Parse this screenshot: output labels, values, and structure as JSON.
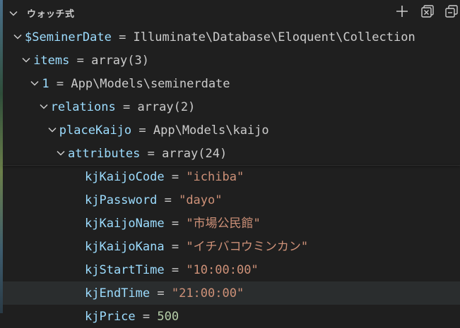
{
  "panel": {
    "title": "ウォッチ式",
    "actions": [
      {
        "icon": "add-icon"
      },
      {
        "icon": "collapse-all-icon"
      },
      {
        "icon": "remove-all-icon"
      }
    ]
  },
  "tree": [
    {
      "name": "$SeminerDate",
      "value": "Illuminate\\Database\\Eloquent\\Collection",
      "value_type": "plain",
      "expandable": true
    },
    {
      "name": "items",
      "value": "array(3)",
      "value_type": "plain",
      "expandable": true
    },
    {
      "name": "1",
      "value": "App\\Models\\seminerdate",
      "value_type": "plain",
      "expandable": true
    },
    {
      "name": "relations",
      "value": "array(2)",
      "value_type": "plain",
      "expandable": true
    },
    {
      "name": "placeKaijo",
      "value": "App\\Models\\kaijo",
      "value_type": "plain",
      "expandable": true
    },
    {
      "name": "attributes",
      "value": "array(24)",
      "value_type": "plain",
      "expandable": true
    },
    {
      "name": "kjKaijoCode",
      "value": "\"ichiba\"",
      "value_type": "string",
      "expandable": false
    },
    {
      "name": "kjPassword",
      "value": "\"dayo\"",
      "value_type": "string",
      "expandable": false
    },
    {
      "name": "kjKaijoName",
      "value": "\"市場公民館\"",
      "value_type": "string",
      "expandable": false
    },
    {
      "name": "kjKaijoKana",
      "value": "\"イチバコウミンカン\"",
      "value_type": "string",
      "expandable": false
    },
    {
      "name": "kjStartTime",
      "value": "\"10:00:00\"",
      "value_type": "string",
      "expandable": false
    },
    {
      "name": "kjEndTime",
      "value": "\"21:00:00\"",
      "value_type": "string",
      "expandable": false,
      "hovered": true
    },
    {
      "name": "kjPrice",
      "value": "500",
      "value_type": "number",
      "expandable": false
    }
  ],
  "colors": {
    "background": "#1f1f1f",
    "variable_name": "#9cdcfe",
    "string_value": "#ce9178",
    "number_value": "#b5cea8",
    "plain_value": "#cccccc",
    "hover_row": "#2a2d2e"
  }
}
